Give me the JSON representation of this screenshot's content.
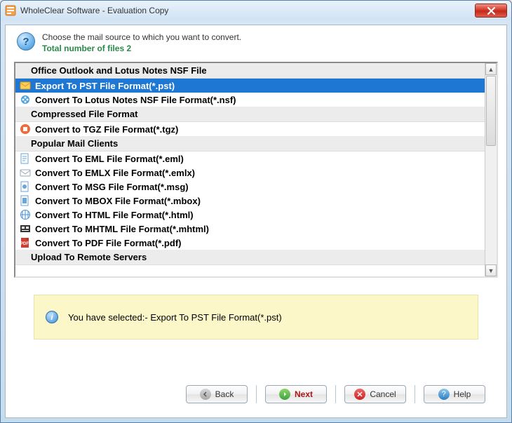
{
  "window": {
    "title": "WholeClear Software - Evaluation Copy"
  },
  "header": {
    "instruction": "Choose the mail source to which you want to convert.",
    "file_count_label": "Total number of files 2"
  },
  "groups": [
    {
      "label": "Office Outlook and Lotus Notes NSF File"
    },
    {
      "label": "Compressed File Format"
    },
    {
      "label": "Popular Mail Clients"
    },
    {
      "label": "Upload To Remote Servers"
    }
  ],
  "items": {
    "pst": {
      "label": "Export To PST File Format(*.pst)"
    },
    "nsf": {
      "label": "Convert To Lotus Notes NSF File Format(*.nsf)"
    },
    "tgz": {
      "label": "Convert to TGZ File Format(*.tgz)"
    },
    "eml": {
      "label": "Convert To EML File Format(*.eml)"
    },
    "emlx": {
      "label": "Convert To EMLX File Format(*.emlx)"
    },
    "msg": {
      "label": "Convert To MSG File Format(*.msg)"
    },
    "mbox": {
      "label": "Convert To MBOX File Format(*.mbox)"
    },
    "html": {
      "label": "Convert To HTML File Format(*.html)"
    },
    "mhtml": {
      "label": "Convert To MHTML File Format(*.mhtml)"
    },
    "pdf": {
      "label": "Convert To PDF File Format(*.pdf)"
    }
  },
  "status": {
    "text": "You have selected:- Export To PST File Format(*.pst)"
  },
  "footer": {
    "back": "Back",
    "next": "Next",
    "cancel": "Cancel",
    "help": "Help"
  },
  "colors": {
    "selection": "#1e77d3",
    "accent_green": "#2a8a4a"
  }
}
